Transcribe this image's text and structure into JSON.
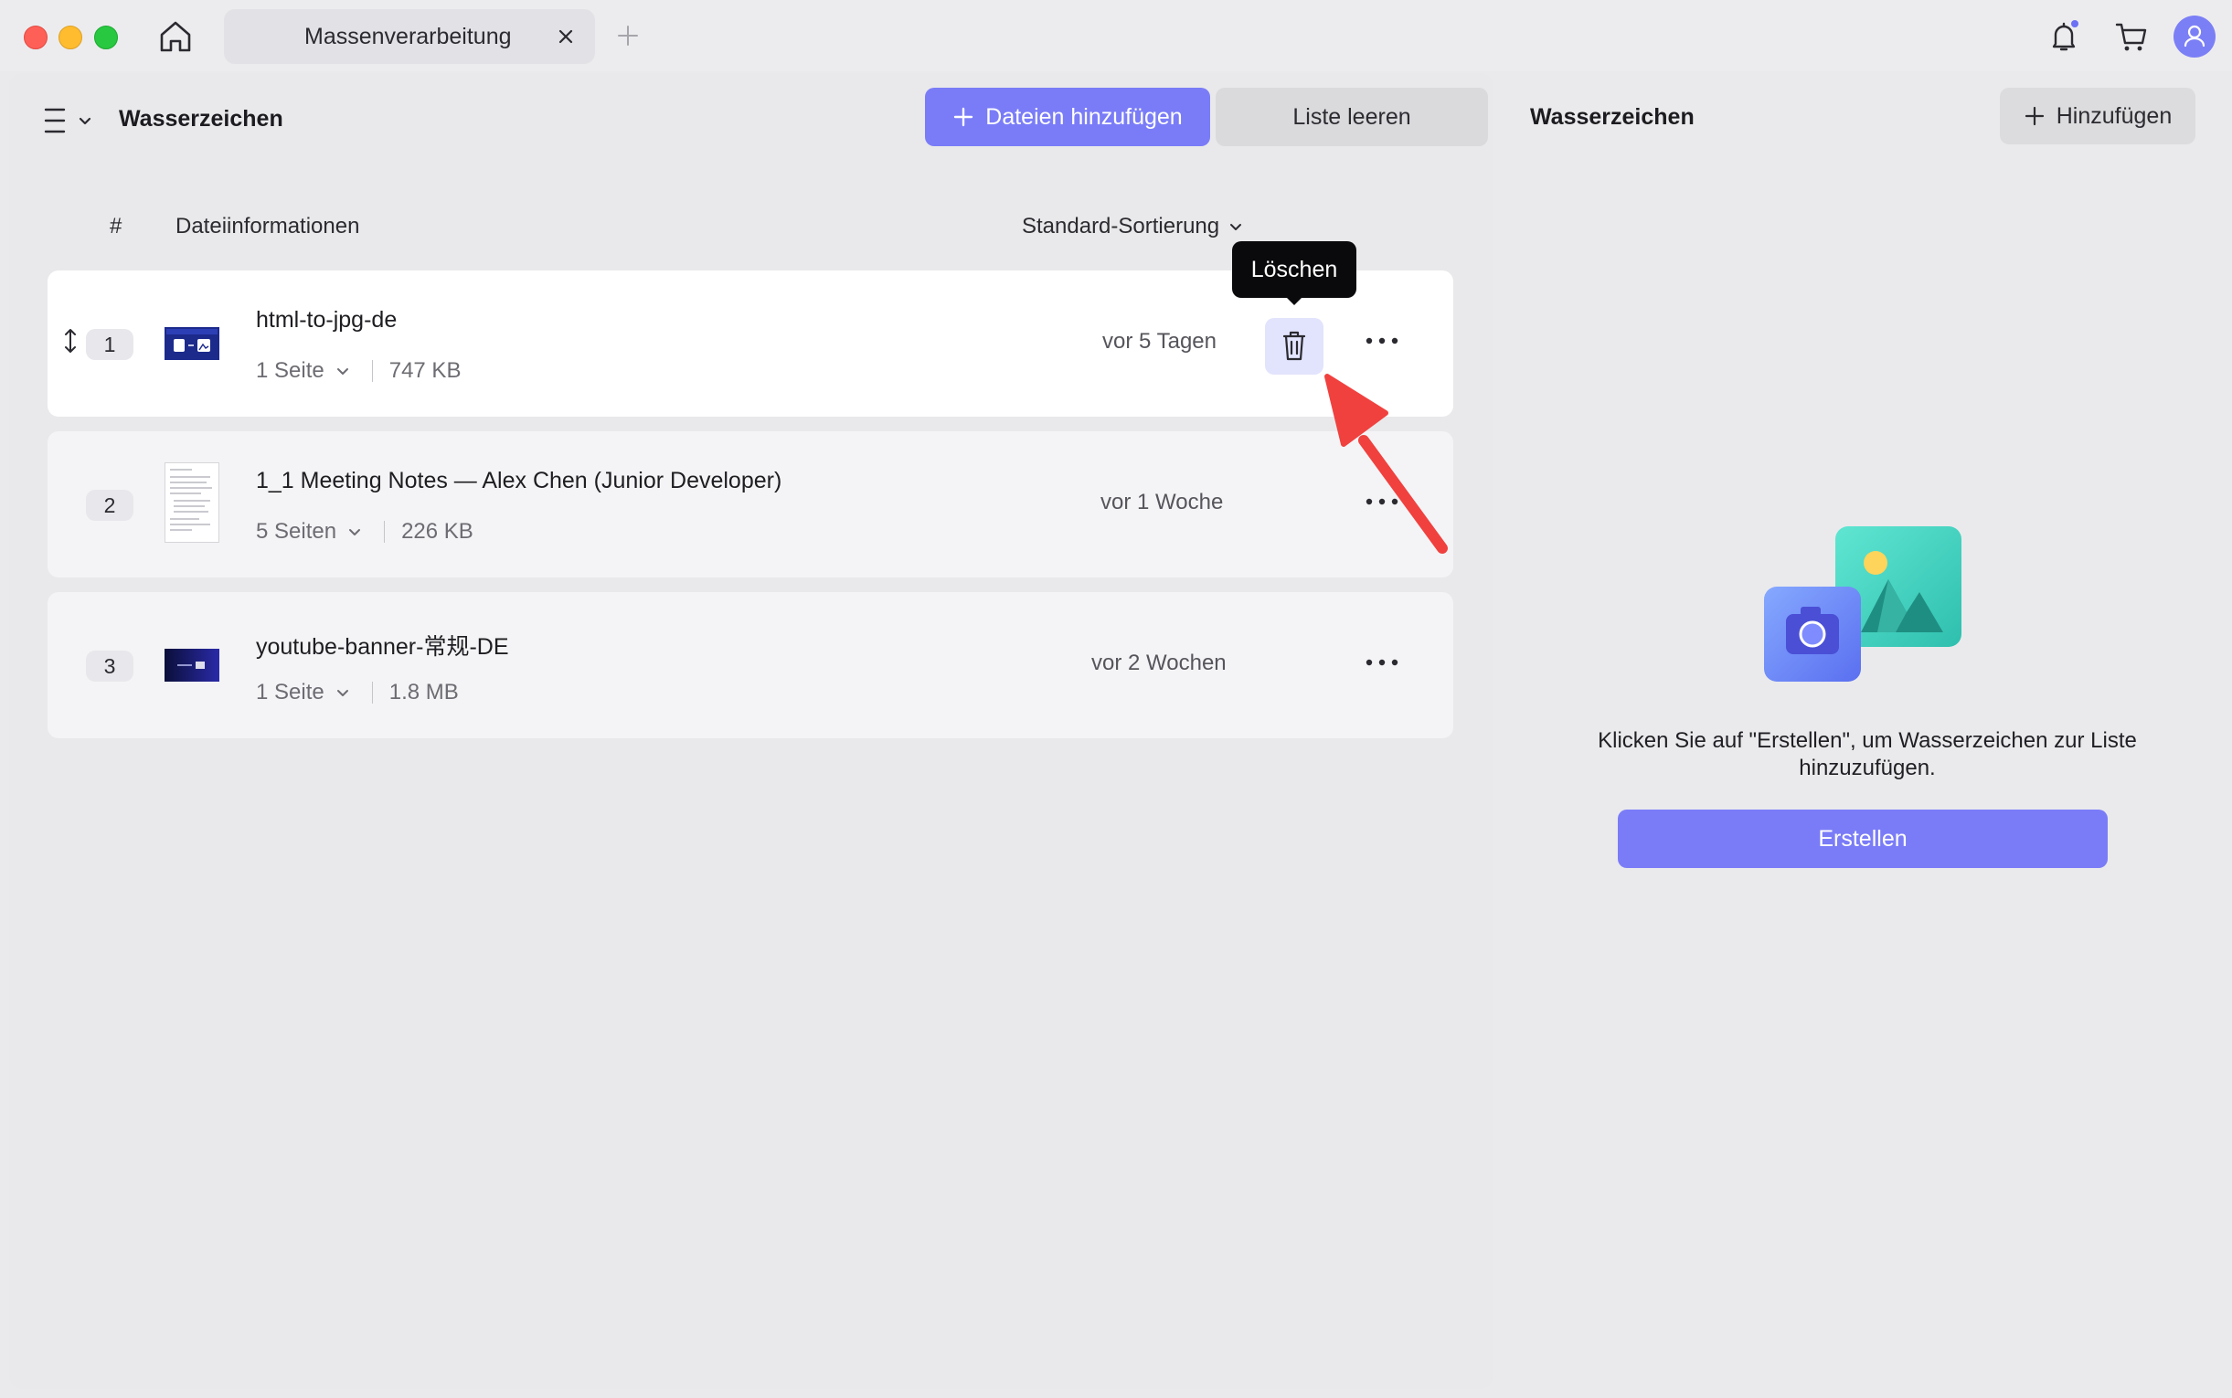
{
  "titlebar": {
    "tab_label": "Massenverarbeitung",
    "icons": [
      "home-icon",
      "close-icon",
      "plus-icon",
      "bell-icon",
      "cart-icon",
      "user-icon"
    ]
  },
  "left": {
    "title": "Wasserzeichen",
    "add_files_label": "Dateien hinzufügen",
    "clear_label": "Liste leeren",
    "columns": {
      "hash": "#",
      "info": "Dateiinformationen",
      "sort": "Standard-Sortierung"
    },
    "rows": [
      {
        "num": "1",
        "name": "html-to-jpg-de",
        "pages": "1 Seite",
        "size": "747 KB",
        "date": "vor 5 Tagen"
      },
      {
        "num": "2",
        "name": "1_1 Meeting Notes — Alex Chen (Junior Developer)",
        "pages": "5 Seiten",
        "size": "226 KB",
        "date": "vor 1 Woche"
      },
      {
        "num": "3",
        "name": "youtube-banner-常规-DE",
        "pages": "1 Seite",
        "size": "1.8 MB",
        "date": "vor 2 Wochen"
      }
    ],
    "tooltip": "Löschen"
  },
  "right": {
    "title": "Wasserzeichen",
    "add_label": "Hinzufügen",
    "hint": "Klicken Sie auf \"Erstellen\", um Wasserzeichen zur Liste hinzuzufügen.",
    "create_label": "Erstellen"
  },
  "colors": {
    "accent": "#7a7cf7",
    "annotation_arrow": "#f0413f"
  }
}
